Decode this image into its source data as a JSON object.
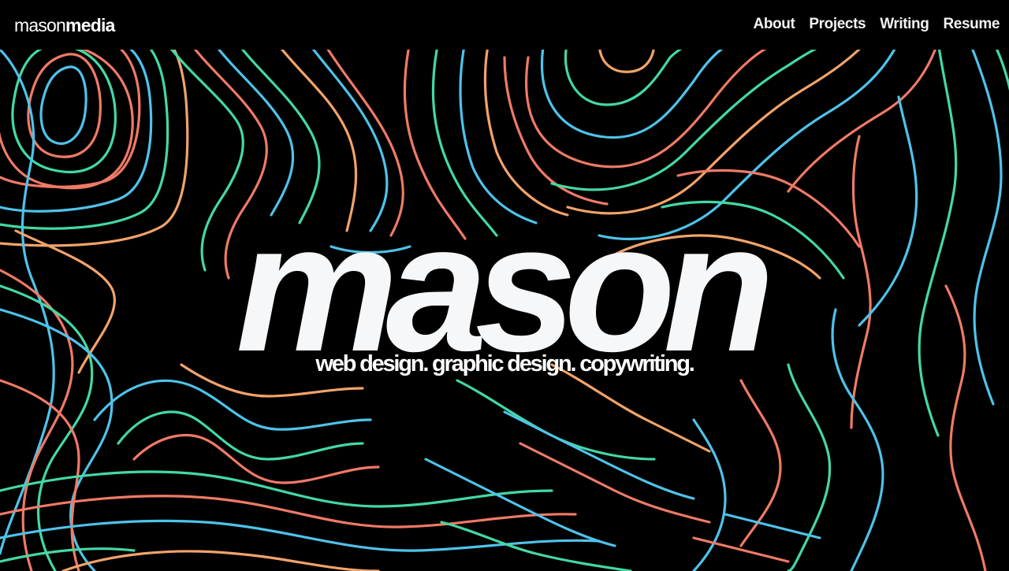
{
  "header": {
    "logo_light": "mason",
    "logo_bold": "media",
    "nav": [
      {
        "label": "About"
      },
      {
        "label": "Projects"
      },
      {
        "label": "Writing"
      },
      {
        "label": "Resume"
      }
    ]
  },
  "hero": {
    "title": "mason",
    "tagline": "web design. graphic design. copywriting.",
    "background": "topographic-contour-lines",
    "colors": {
      "background": "#000000",
      "coral": "#f07a66",
      "mint": "#43d9a3",
      "sky": "#4ec3ea",
      "peach": "#f2a36a"
    }
  }
}
